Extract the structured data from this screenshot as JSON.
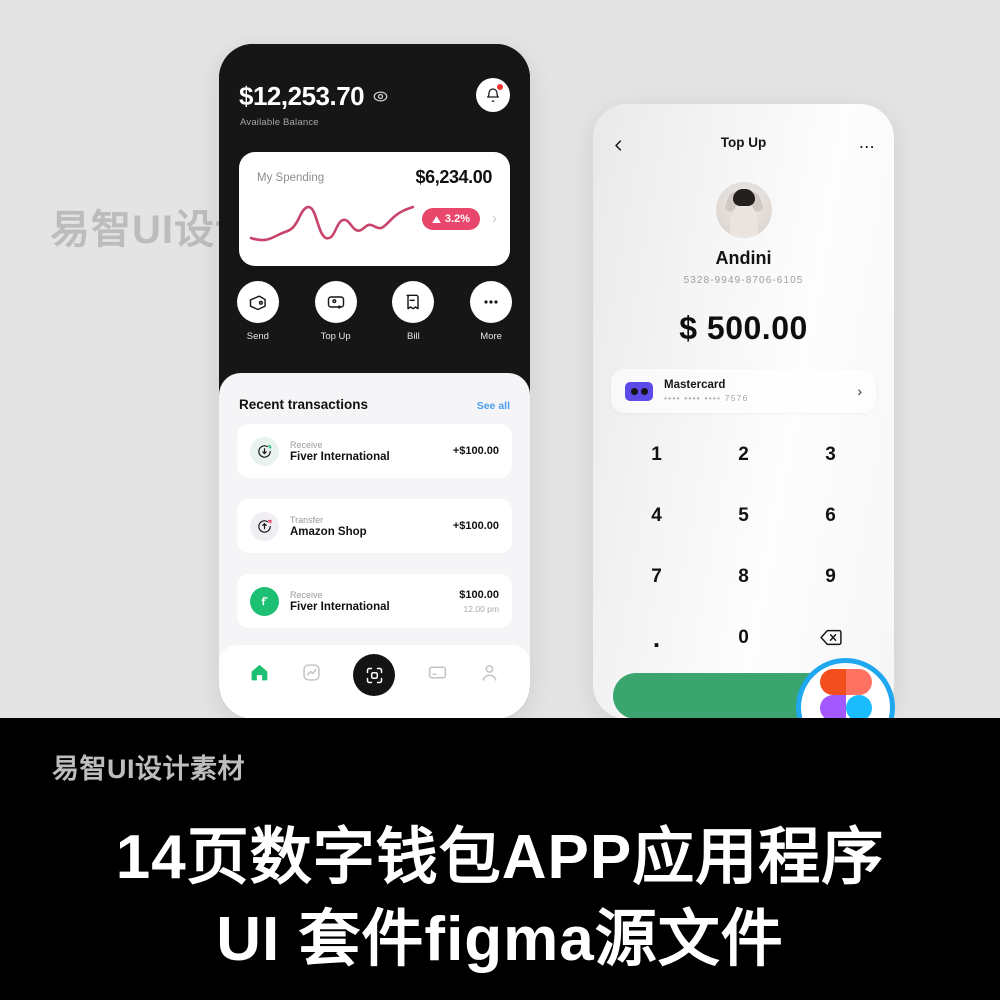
{
  "watermark": {
    "text": "易智UI设计素材"
  },
  "left_phone": {
    "balance": {
      "amount": "$12,253.70",
      "label": "Available Balance",
      "eye_icon": "eye-icon"
    },
    "notification": {
      "icon": "bell-icon",
      "has_badge": true
    },
    "spending_card": {
      "label": "My Spending",
      "amount": "$6,234.00",
      "change": "3.2%",
      "change_direction": "up",
      "change_color": "#e8466a",
      "chevron": "chevron-right-icon"
    },
    "quick_actions": [
      {
        "label": "Send",
        "icon": "wallet-send-icon"
      },
      {
        "label": "Top Up",
        "icon": "card-plus-icon"
      },
      {
        "label": "Bill",
        "icon": "bill-icon"
      },
      {
        "label": "More",
        "icon": "more-dots-icon"
      }
    ],
    "recent": {
      "title": "Recent transactions",
      "see_all": "See all",
      "see_all_color": "#4a9df0",
      "transactions": [
        {
          "type": "Receive",
          "name": "Fiver International",
          "amount": "+$100.00",
          "time": "",
          "icon": "receive-arrow-icon"
        },
        {
          "type": "Transfer",
          "name": "Amazon Shop",
          "amount": "+$100.00",
          "time": "",
          "icon": "transfer-arrow-icon"
        },
        {
          "type": "Receive",
          "name": "Fiver International",
          "amount": "$100.00",
          "time": "12.00 pm",
          "icon": "fiverr-icon"
        }
      ]
    },
    "nav": [
      {
        "name": "home",
        "icon": "home-icon",
        "active": true,
        "color": "#1dbf73"
      },
      {
        "name": "stats",
        "icon": "chart-icon",
        "active": false
      },
      {
        "name": "scan",
        "icon": "qr-scan-icon",
        "active": false
      },
      {
        "name": "cards",
        "icon": "card-icon",
        "active": false
      },
      {
        "name": "profile",
        "icon": "person-icon",
        "active": false
      }
    ]
  },
  "right_phone": {
    "header": {
      "title": "Top Up",
      "back_icon": "chevron-left-icon",
      "more_icon": "more-dots-icon"
    },
    "profile": {
      "name": "Andini",
      "card_number": "5328-9949-8706-6105",
      "avatar": "user-photo"
    },
    "amount": "$ 500.00",
    "payment_method": {
      "name": "Mastercard",
      "masked": "•••• •••• •••• 7576",
      "icon": "mastercard-icon",
      "chevron": "chevron-right-icon"
    },
    "keypad": [
      "1",
      "2",
      "3",
      "4",
      "5",
      "6",
      "7",
      "8",
      "9",
      ".",
      "0",
      "backspace"
    ],
    "confirm_button": {
      "label": "",
      "color": "#3aa56f"
    }
  },
  "figma_badge": {
    "icon": "figma-logo-icon",
    "ring_color": "#1fa8f0"
  },
  "banner": {
    "brand": "易智UI设计素材",
    "headline_line1": "14页数字钱包APP应用程序",
    "headline_line2": "UI 套件figma源文件"
  }
}
